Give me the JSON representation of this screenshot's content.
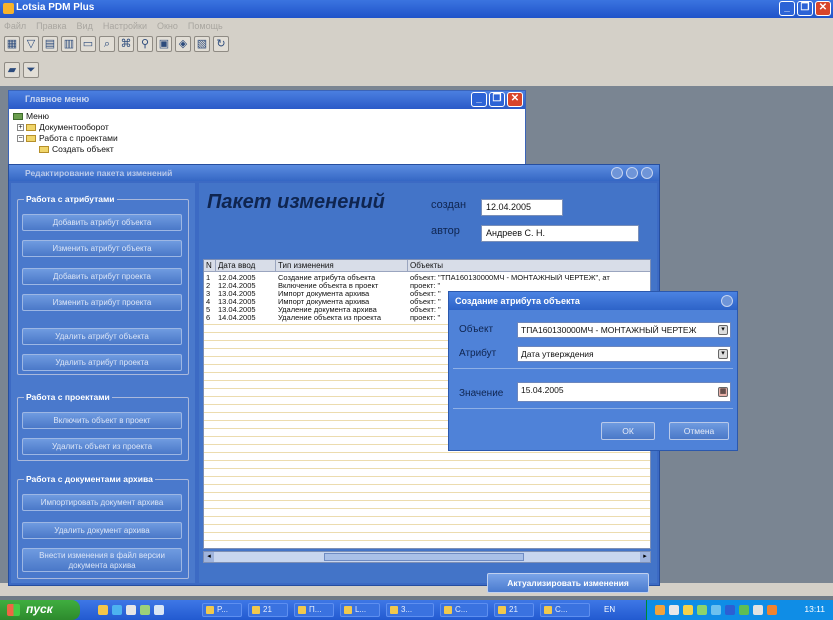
{
  "app": {
    "title": "Lotsia PDM Plus",
    "menu": [
      "Файл",
      "Правка",
      "Вид",
      "Настройки",
      "Окно",
      "Помощь"
    ]
  },
  "main_menu": {
    "title": "Главное меню",
    "tree": [
      {
        "label": "Меню",
        "level": 0
      },
      {
        "label": "Документооборот",
        "level": 1
      },
      {
        "label": "Работа с проектами",
        "level": 1
      },
      {
        "label": "Создать объект",
        "level": 2
      }
    ]
  },
  "edit_window": {
    "title": "Редактирование пакета изменений",
    "groups": {
      "attributes": {
        "label": "Работа с атрибутами",
        "buttons": [
          "Добавить атрибут объекта",
          "Изменить атрибут объекта",
          "Добавить атрибут проекта",
          "Изменить атрибут проекта",
          "Удалить атрибут объекта",
          "Удалить атрибут проекта"
        ]
      },
      "projects": {
        "label": "Работа с проектами",
        "buttons": [
          "Включить объект в проект",
          "Удалить объект из проекта"
        ]
      },
      "archive": {
        "label": "Работа с документами архива",
        "buttons": [
          "Импортировать документ архива",
          "Удалить документ архива",
          "Внести изменения в файл версии документа архива"
        ]
      }
    },
    "package_title": "Пакет изменений",
    "created_label": "создан",
    "created_value": "12.04.2005",
    "author_label": "автор",
    "author_value": "Андреев С. Н.",
    "grid": {
      "columns": [
        "N",
        "Дата ввод",
        "Тип изменения",
        "Объекты"
      ],
      "rows": [
        [
          "1",
          "12.04.2005",
          "Создание атрибута объекта",
          "объект: \"ТПА160130000МЧ - МОНТАЖНЫЙ ЧЕРТЕЖ\", ат"
        ],
        [
          "2",
          "12.04.2005",
          "Включение объекта в проект",
          "проект: \""
        ],
        [
          "3",
          "13.04.2005",
          "Импорт документа архива",
          "объект: \""
        ],
        [
          "4",
          "13.04.2005",
          "Импорт документа архива",
          "объект: \""
        ],
        [
          "5",
          "13.04.2005",
          "Удаление документа архива",
          "объект: \""
        ],
        [
          "6",
          "14.04.2005",
          "Удаление объекта из проекта",
          "проект: \""
        ]
      ]
    },
    "actualize_label": "Актуализировать изменения"
  },
  "dialog": {
    "title": "Создание атрибута объекта",
    "object_label": "Объект",
    "object_value": "ТПА160130000МЧ - МОНТАЖНЫЙ ЧЕРТЕЖ",
    "attribute_label": "Атрибут",
    "attribute_value": "Дата утверждения",
    "value_label": "Значение",
    "value_value": "15.04.2005",
    "ok_label": "ОК",
    "cancel_label": "Отмена"
  },
  "taskbar": {
    "start_label": "пуск",
    "tasks": [
      "P...",
      "21",
      "П...",
      "L...",
      "3...",
      "C...",
      "21",
      "C..."
    ],
    "lang": "EN",
    "clock": "13:11"
  }
}
